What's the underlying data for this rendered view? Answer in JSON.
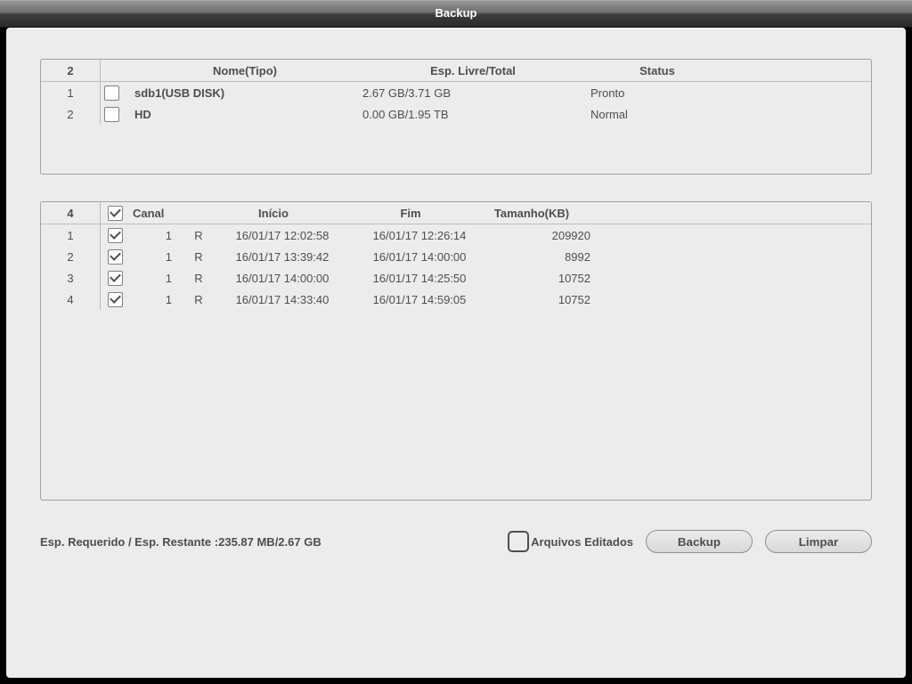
{
  "window": {
    "title": "Backup"
  },
  "devices": {
    "count_label": "2",
    "headers": {
      "name": "Nome(Tipo)",
      "space": "Esp. Livre/Total",
      "status": "Status"
    },
    "rows": [
      {
        "idx": "1",
        "checked": false,
        "name": "sdb1(USB DISK)",
        "space": "2.67 GB/3.71 GB",
        "status": "Pronto"
      },
      {
        "idx": "2",
        "checked": false,
        "name": "HD",
        "space": "0.00 GB/1.95 TB",
        "status": "Normal"
      }
    ]
  },
  "files": {
    "count_label": "4",
    "all_checked": true,
    "headers": {
      "canal": "Canal",
      "inicio": "Início",
      "fim": "Fim",
      "tamanho": "Tamanho(KB)"
    },
    "rows": [
      {
        "idx": "1",
        "checked": true,
        "canal": "1",
        "tipo": "R",
        "inicio": "16/01/17 12:02:58",
        "fim": "16/01/17 12:26:14",
        "tamanho": "209920"
      },
      {
        "idx": "2",
        "checked": true,
        "canal": "1",
        "tipo": "R",
        "inicio": "16/01/17 13:39:42",
        "fim": "16/01/17 14:00:00",
        "tamanho": "8992"
      },
      {
        "idx": "3",
        "checked": true,
        "canal": "1",
        "tipo": "R",
        "inicio": "16/01/17 14:00:00",
        "fim": "16/01/17 14:25:50",
        "tamanho": "10752"
      },
      {
        "idx": "4",
        "checked": true,
        "canal": "1",
        "tipo": "R",
        "inicio": "16/01/17 14:33:40",
        "fim": "16/01/17 14:59:05",
        "tamanho": "10752"
      }
    ]
  },
  "footer": {
    "space_label": "Esp. Requerido / Esp. Restante  :",
    "space_value": "235.87 MB/2.67 GB",
    "edited_label": "Arquivos Editados",
    "edited_checked": false,
    "backup_label": "Backup",
    "clear_label": "Limpar"
  }
}
